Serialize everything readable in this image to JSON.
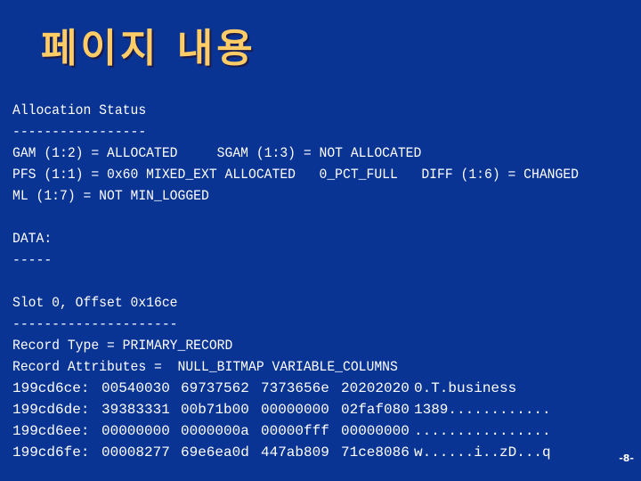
{
  "title": "페이지 내용",
  "allocation": {
    "heading": "Allocation Status",
    "underline": "-----------------",
    "lines": [
      "GAM (1:2) = ALLOCATED     SGAM (1:3) = NOT ALLOCATED",
      "PFS (1:1) = 0x60 MIXED_EXT ALLOCATED   0_PCT_FULL   DIFF (1:6) = CHANGED",
      "ML (1:7) = NOT MIN_LOGGED"
    ]
  },
  "data_section": {
    "heading": "DATA:",
    "underline": "-----"
  },
  "slot": {
    "heading": "Slot 0, Offset 0x16ce",
    "underline": "---------------------",
    "record_type": "Record Type = PRIMARY_RECORD",
    "record_attributes": "Record Attributes =  NULL_BITMAP VARIABLE_COLUMNS"
  },
  "hex_dump": [
    {
      "address": "199cd6ce:",
      "words": [
        "00540030",
        "69737562",
        "7373656e",
        "20202020"
      ],
      "ascii": "0.T.business"
    },
    {
      "address": "199cd6de:",
      "words": [
        "39383331",
        "00b71b00",
        "00000000",
        "02faf080"
      ],
      "ascii": "1389............"
    },
    {
      "address": "199cd6ee:",
      "words": [
        "00000000",
        "0000000a",
        "00000fff",
        "00000000"
      ],
      "ascii": "................"
    },
    {
      "address": "199cd6fe:",
      "words": [
        "00008277",
        "69e6ea0d",
        "447ab809",
        "71ce8086"
      ],
      "ascii": "w......i..zD...q"
    }
  ],
  "page_number": "-8-"
}
